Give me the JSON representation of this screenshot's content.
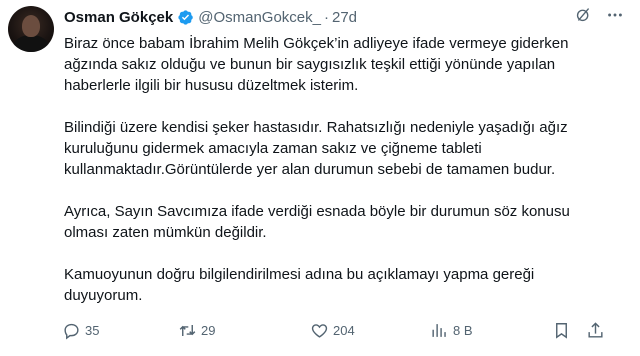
{
  "tweet": {
    "author_name": "Osman Gökçek",
    "handle": "@OsmanGokcek_",
    "separator": "·",
    "time": "27d",
    "paragraphs": [
      "Biraz önce babam İbrahim Melih Gökçek’in adliyeye ifade vermeye giderken\nağzında sakız olduğu ve bunun bir saygısızlık teşkil ettiği yönünde yapılan\nhaberlerle ilgili bir hususu düzeltmek isterim.",
      "Bilindiği üzere kendisi şeker hastasıdır. Rahatsızlığı nedeniyle yaşadığı ağız\nkuruluğunu gidermek amacıyla zaman  sakız ve çiğneme tableti\nkullanmaktadır.Görüntülerde yer alan durumun sebebi de tamamen budur.",
      "Ayrıca, Sayın Savcımıza ifade verdiği esnada böyle bir durumun söz konusu\nolması zaten mümkün değildir.",
      "Kamuoyunun doğru bilgilendirilmesi adına bu açıklamayı yapma gereği\nduyuyorum."
    ]
  },
  "actions": {
    "replies": "35",
    "retweets": "29",
    "likes": "204",
    "views": "8 B"
  },
  "icons": {
    "verified": "verified-badge-icon",
    "grok": "grok-icon",
    "more": "more-icon",
    "reply": "reply-icon",
    "retweet": "retweet-icon",
    "like": "heart-icon",
    "views": "views-icon",
    "bookmark": "bookmark-icon",
    "share": "share-icon"
  },
  "colors": {
    "text": "#0f1419",
    "secondary": "#536471",
    "verified": "#1d9bf0"
  }
}
